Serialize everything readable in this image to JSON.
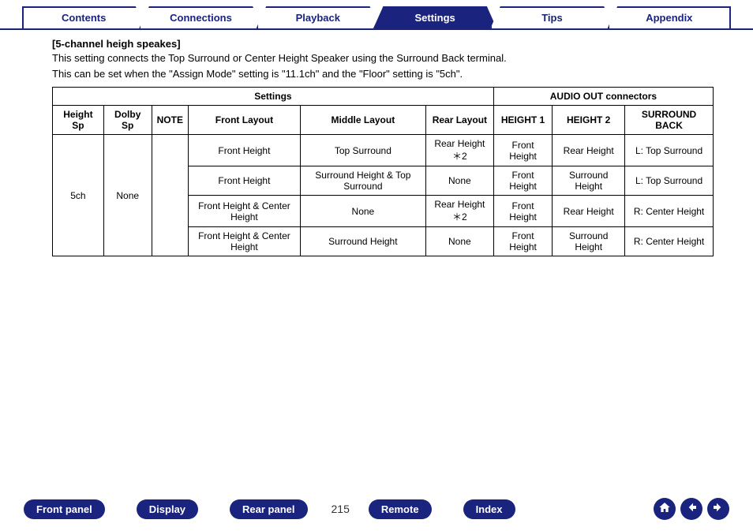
{
  "tabs": {
    "contents": "Contents",
    "connections": "Connections",
    "playback": "Playback",
    "settings": "Settings",
    "tips": "Tips",
    "appendix": "Appendix"
  },
  "section": {
    "heading": "[5-channel heigh speakes]",
    "desc1": "This setting connects the Top Surround or Center Height Speaker using the Surround Back terminal.",
    "desc2": "This can be set when the \"Assign Mode\" setting is \"11.1ch\" and the \"Floor\" setting is \"5ch\"."
  },
  "table": {
    "group_settings": "Settings",
    "group_audio": "AUDIO OUT connectors",
    "headers": {
      "height_sp": "Height Sp",
      "dolby_sp": "Dolby Sp",
      "note": "NOTE",
      "front_layout": "Front Layout",
      "middle_layout": "Middle Layout",
      "rear_layout": "Rear Layout",
      "height1": "HEIGHT 1",
      "height2": "HEIGHT 2",
      "surround_back": "SURROUND BACK"
    },
    "height_sp_value": "5ch",
    "dolby_sp_value": "None",
    "rows": [
      {
        "front": "Front Height",
        "middle": "Top Surround",
        "rear": "Rear Height＊2",
        "h1": "Front Height",
        "h2": "Rear Height",
        "sb": "L: Top Surround"
      },
      {
        "front": "Front Height",
        "middle": "Surround Height & Top Surround",
        "rear": "None",
        "h1": "Front Height",
        "h2": "Surround Height",
        "sb": "L: Top Surround"
      },
      {
        "front": "Front Height & Center Height",
        "middle": "None",
        "rear": "Rear Height＊2",
        "h1": "Front Height",
        "h2": "Rear Height",
        "sb": "R: Center Height"
      },
      {
        "front": "Front Height & Center Height",
        "middle": "Surround Height",
        "rear": "None",
        "h1": "Front Height",
        "h2": "Surround Height",
        "sb": "R: Center Height"
      }
    ]
  },
  "footer": {
    "front_panel": "Front panel",
    "display": "Display",
    "rear_panel": "Rear panel",
    "remote": "Remote",
    "index": "Index",
    "page": "215"
  }
}
